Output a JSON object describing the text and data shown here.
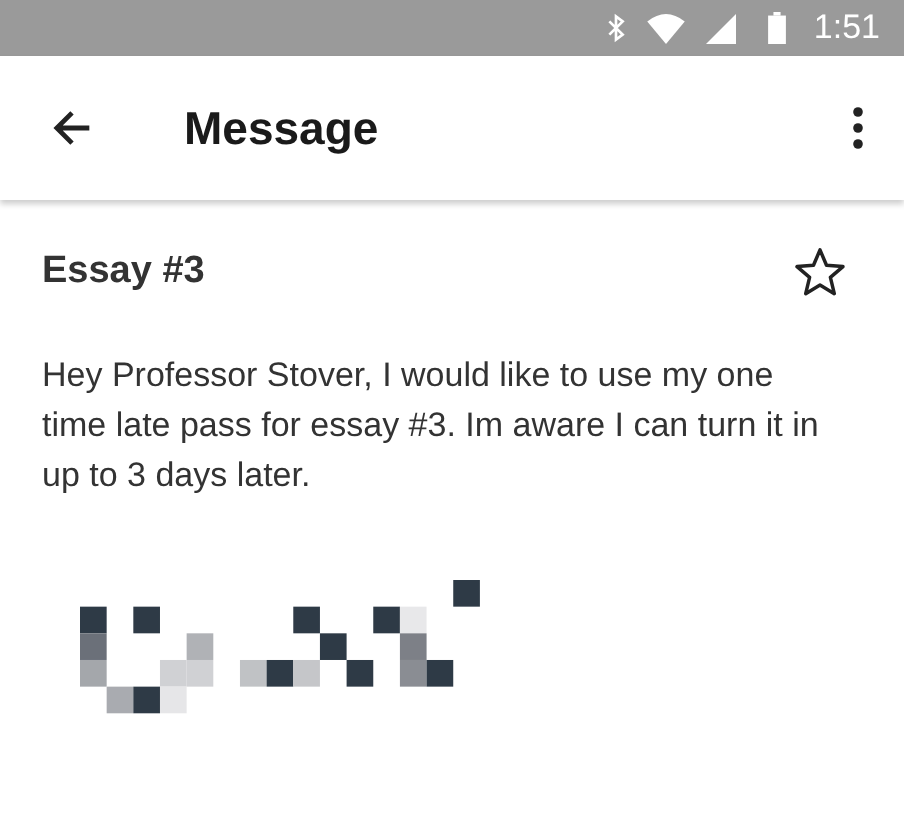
{
  "status_bar": {
    "time": "1:51"
  },
  "app_bar": {
    "title": "Message"
  },
  "message": {
    "subject": "Essay #3",
    "starred": false,
    "body": "Hey Professor Stover, I would like to use my one time late pass for essay #3. Im aware I can turn it in up to 3 days later."
  }
}
